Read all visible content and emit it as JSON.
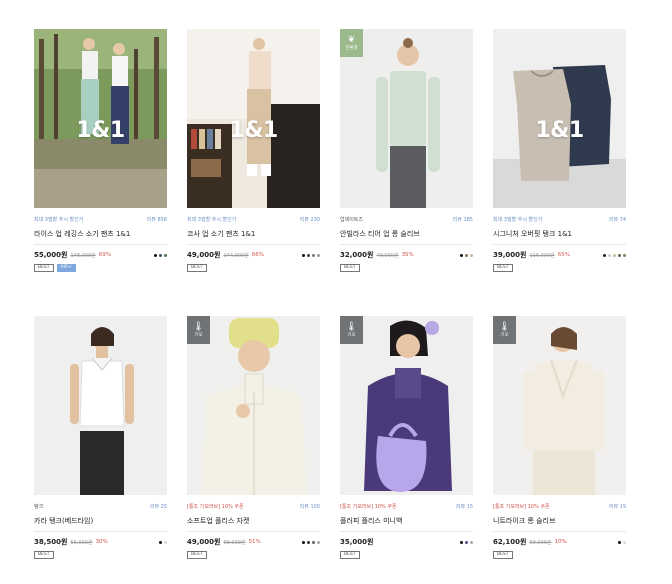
{
  "products": [
    {
      "overlay": "1&1",
      "badge": "",
      "badge_icon": "",
      "promo": "최대 3벌할 추시 할인가",
      "reviews": "리뷰 858",
      "name": "라이스 업 레깅스 소기 팬츠 1&1",
      "price": "55,000원",
      "orig": "178,000원",
      "disc": "69%",
      "tags": [
        "BEST",
        "AIR+"
      ],
      "swatches": [
        "#111111",
        "#33556b",
        "#4f6f57"
      ]
    },
    {
      "overlay": "1&1",
      "badge": "",
      "badge_icon": "",
      "promo": "최대 3벌할 추시 할인가",
      "reviews": "리뷰 230",
      "name": "코사 업 소기 팬츠 1&1",
      "price": "49,000원",
      "orig": "144,000원",
      "disc": "66%",
      "tags": [
        "BEST"
      ],
      "swatches": [
        "#111111",
        "#444444",
        "#777777",
        "#999999"
      ]
    },
    {
      "overlay": "",
      "badge": "친환경",
      "badge_icon": "leaf-icon",
      "promo": "업데이트즈",
      "reviews": "리뷰 185",
      "name": "안빌라스 티어 업 롱 슬리브",
      "price": "32,000원",
      "orig": "49,000원",
      "disc": "35%",
      "tags": [
        "BEST"
      ],
      "swatches": [
        "#111111",
        "#8a7a5a",
        "#c9b8a0"
      ]
    },
    {
      "overlay": "1&1",
      "badge": "",
      "badge_icon": "",
      "promo": "최대 3벌할 추시 할인가",
      "reviews": "리뷰 74",
      "name": "시그니처 오버핏 탱크 1&1",
      "price": "39,000원",
      "orig": "116,000원",
      "disc": "65%",
      "tags": [
        "BEST"
      ],
      "swatches": [
        "#222222",
        "#cccccc",
        "#c8b89a",
        "#556b4f",
        "#8a7a5a"
      ]
    },
    {
      "overlay": "",
      "badge": "",
      "badge_icon": "",
      "promo": "탱크",
      "reviews": "리뷰 25",
      "name": "카라 탱크(베드타임)",
      "price": "38,500원",
      "orig": "55,000원",
      "disc": "30%",
      "tags": [
        "BEST"
      ],
      "swatches": [
        "#111111",
        "#dddddd"
      ]
    },
    {
      "overlay": "",
      "badge": "기모",
      "badge_icon": "thermometer-icon",
      "promo": "[통조 기모러브] 10% 쿠폰",
      "reviews": "리뷰 100",
      "name": "소프트업 플리스 자켓",
      "price": "49,000원",
      "orig": "99,000원",
      "disc": "51%",
      "tags": [
        "BEST"
      ],
      "swatches": [
        "#111111",
        "#333333",
        "#666666",
        "#aaaaaa"
      ]
    },
    {
      "overlay": "",
      "badge": "기모",
      "badge_icon": "thermometer-icon",
      "promo": "[통조 기모러브] 10% 쿠폰",
      "reviews": "리뷰 15",
      "name": "플러피 플리스 미니백",
      "price": "35,000원",
      "orig": "",
      "disc": "",
      "tags": [
        "BEST"
      ],
      "swatches": [
        "#111111",
        "#5a4a8a",
        "#aaaaaa"
      ]
    },
    {
      "overlay": "",
      "badge": "기모",
      "badge_icon": "thermometer-icon",
      "promo": "[통조 기모러브] 10% 쿠폰",
      "reviews": "리뷰 19",
      "name": "니트라이크 롱 슬리브",
      "price": "62,100원",
      "orig": "69,000원",
      "disc": "10%",
      "tags": [
        "BEST"
      ],
      "swatches": [
        "#111111",
        "#dddddd"
      ]
    }
  ]
}
